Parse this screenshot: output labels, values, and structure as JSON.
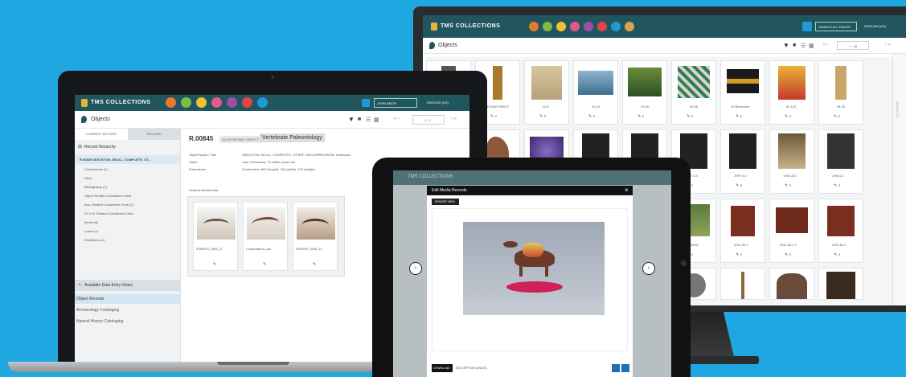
{
  "app": {
    "title": "TMS COLLECTIONS"
  },
  "colors": {
    "background": "#1ea7e1",
    "toolbar": "#22565f",
    "icons": [
      "#e77a2b",
      "#7fba42",
      "#f2c230",
      "#e35a8a",
      "#9b4fa6",
      "#e04646",
      "#1f9ad6",
      "#d8a44a"
    ]
  },
  "monitor": {
    "section_title": "Objects",
    "user_label": "SEARCH ALL FIELDS",
    "lang_label": "ENGLISH (US)",
    "pager": "1 - 48",
    "side_text": "RESULTS",
    "row1": [
      {
        "cap": ""
      },
      {
        "cap": "ROAM 1999.37"
      },
      {
        "cap": "11.8"
      },
      {
        "cap": "91.34"
      },
      {
        "cap": "91.55"
      },
      {
        "cap": "09.36"
      },
      {
        "cap": "20 Blossoms"
      },
      {
        "cap": "81.122"
      },
      {
        "cap": "06.36"
      }
    ],
    "row2": [
      {
        "cap": ""
      },
      {
        "cap": ""
      },
      {
        "cap": ""
      },
      {
        "cap": ""
      },
      {
        "cap": ""
      },
      {
        "cap": "1997.4.3"
      },
      {
        "cap": "1997.4.4"
      },
      {
        "cap": "1992.221"
      },
      {
        "cap": "1994.21"
      }
    ],
    "row3": [
      {
        "cap": "2008.90"
      },
      {
        "cap": "2011.83.1"
      },
      {
        "cap": "2011.83.1.1"
      },
      {
        "cap": "2011.83.2"
      }
    ]
  },
  "laptop": {
    "section_title": "Objects",
    "tab_current": "CURRENT RECORD",
    "tab_related": "RELATED",
    "record_hierarchy": "Record Hierarchy",
    "tree_root": "R.00845 SKELETON, SKULL, COMPLETE, OT...",
    "tree_items": [
      "Components (1)",
      "Sites",
      "Bibliography (1)",
      "Object Related Constituent Xrefs",
      "Acq. Related Constituent Xrefs (2)",
      "Ex Coll. Related Constituent Xrefs",
      "Media (3)",
      "Loans (1)",
      "Exhibitions (1)"
    ],
    "data_entry_views": "Available Data Entry Views",
    "views": [
      "Object Records",
      "Archaeology Cataloging",
      "Natural History Cataloging"
    ],
    "object_number": "R.00845",
    "accessioned_badge": "ACCESSIONED OBJECT",
    "department": "Vertebrate Paleontology",
    "fields": [
      {
        "label": "Object Name / Title",
        "value": "SKELETON; SKULL; COMPLETE; OTHER; SKIN IMPRESSION; Hadrosaur"
      },
      {
        "label": "Dates",
        "value": "Late Cretaceous; 70 million years old"
      },
      {
        "label": "Dimensions",
        "value": "Centimetres: 600 (length), 134 (width), 270 (height)"
      }
    ],
    "related_media_label": "Related Media/Xrefs",
    "media": [
      {
        "cap": "ROM2007_9406_22"
      },
      {
        "cap": "Corythosaurus_cas..."
      },
      {
        "cap": "ROM2007_9408_22"
      }
    ],
    "user_label": "JOHN SMITH",
    "lang_label": "ENGLISH (US)",
    "pager": "1 / 1"
  },
  "tablet": {
    "dialog_title": "Edit Media Records",
    "dialog_close": "×",
    "top_button": "RENDER VIEW",
    "footer_button": "DOWNLOAD",
    "footer_text": "DESCRIPTION (IMAGE)",
    "bg_title": "TMS COLLECTIONS"
  }
}
